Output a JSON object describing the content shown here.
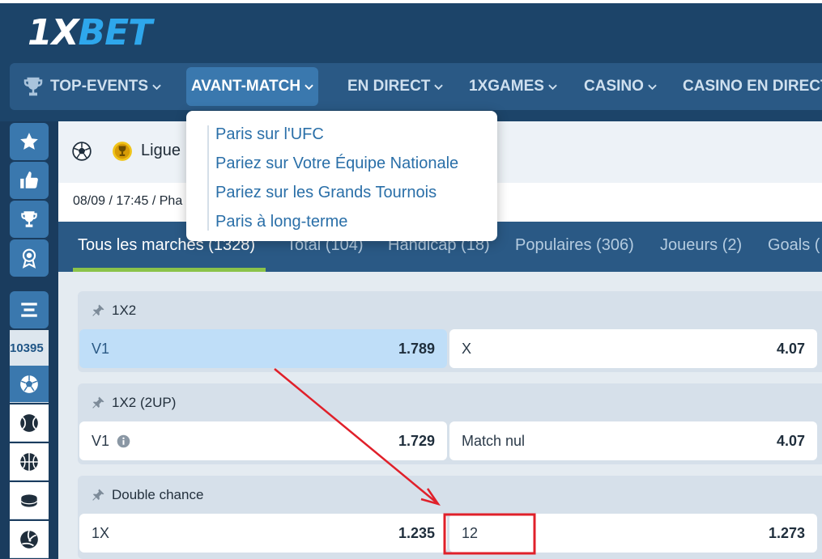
{
  "header": {
    "logo_part1": "1X",
    "logo_part2": "BET"
  },
  "nav": {
    "items": [
      {
        "label": "TOP-EVENTS"
      },
      {
        "label": "AVANT-MATCH"
      },
      {
        "label": "EN DIRECT"
      },
      {
        "label": "1XGAMES"
      },
      {
        "label": "CASINO"
      },
      {
        "label": "CASINO EN DIRECT"
      }
    ]
  },
  "dropdown": {
    "items": [
      {
        "label": "Paris sur l'UFC"
      },
      {
        "label": "Pariez sur Votre Équipe Nationale"
      },
      {
        "label": "Pariez sur les Grands Tournois"
      },
      {
        "label": "Paris à long-terme"
      }
    ]
  },
  "sidebar": {
    "event_count": "10395"
  },
  "match": {
    "league": "Ligue",
    "datetime": "08/09 / 17:45 / Pha"
  },
  "tabs": [
    {
      "label": "Tous les marchés (1328)"
    },
    {
      "label": "Total (104)"
    },
    {
      "label": "Handicap (18)"
    },
    {
      "label": "Populaires (306)"
    },
    {
      "label": "Joueurs (2)"
    },
    {
      "label": "Goals ("
    }
  ],
  "markets": [
    {
      "title": "1X2",
      "odds": [
        {
          "label": "V1",
          "value": "1.789"
        },
        {
          "label": "X",
          "value": "4.07"
        }
      ]
    },
    {
      "title": "1X2 (2UP)",
      "odds": [
        {
          "label": "V1",
          "value": "1.729"
        },
        {
          "label": "Match nul",
          "value": "4.07"
        }
      ]
    },
    {
      "title": "Double chance",
      "odds": [
        {
          "label": "1X",
          "value": "1.235"
        },
        {
          "label": "12",
          "value": "1.273"
        }
      ]
    }
  ],
  "colors": {
    "header_bg": "#1c4469",
    "nav_bg": "#2a5985",
    "accent": "#3a78ae",
    "logo_accent": "#2ea7ec",
    "tab_underline": "#8bc34a",
    "selected_odd": "#bfdef8",
    "annotation": "#e0202a"
  }
}
